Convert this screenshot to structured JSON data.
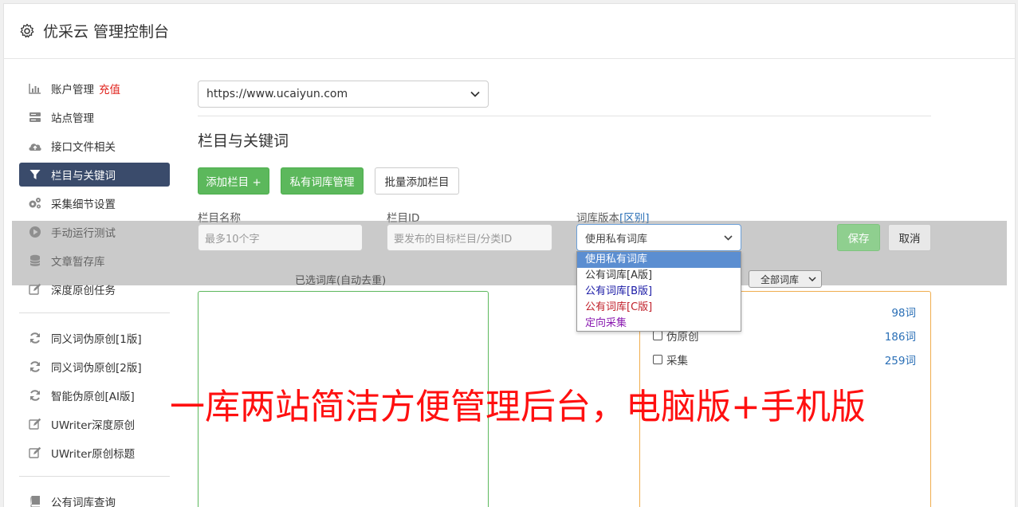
{
  "app": {
    "title": "优采云 管理控制台"
  },
  "sidebar": {
    "items": [
      {
        "label": "账户管理",
        "badge": "充值"
      },
      {
        "label": "站点管理"
      },
      {
        "label": "接口文件相关"
      },
      {
        "label": "栏目与关键词"
      },
      {
        "label": "采集细节设置"
      },
      {
        "label": "手动运行测试"
      },
      {
        "label": "文章暂存库"
      },
      {
        "label": "深度原创任务"
      }
    ],
    "items2": [
      {
        "label": "同义词伪原创[1版]"
      },
      {
        "label": "同义词伪原创[2版]"
      },
      {
        "label": "智能伪原创[AI版]"
      },
      {
        "label": "UWriter深度原创"
      },
      {
        "label": "UWriter原创标题"
      }
    ],
    "items3": [
      {
        "label": "公有词库查询"
      }
    ]
  },
  "site_select": {
    "value": "https://www.ucaiyun.com"
  },
  "section": {
    "title": "栏目与关键词"
  },
  "toolbar": {
    "add_column": "添加栏目 +",
    "private_lib": "私有词库管理",
    "batch_add": "批量添加栏目"
  },
  "form": {
    "name_label": "栏目名称",
    "name_placeholder": "最多10个字",
    "id_label": "栏目ID",
    "id_placeholder": "要发布的目标栏目/分类ID",
    "version_label": "词库版本",
    "version_link": "[区别]",
    "version_value": "使用私有词库",
    "save": "保存",
    "cancel": "取消"
  },
  "dropdown": {
    "options": [
      {
        "label": "使用私有词库",
        "color": "#ffffff"
      },
      {
        "label": "公有词库[A版]",
        "color": "#333333"
      },
      {
        "label": "公有词库[B版]",
        "color": "#1a1aa6"
      },
      {
        "label": "公有词库[C版]",
        "color": "#c0202a"
      },
      {
        "label": "定向采集",
        "color": "#8a1ab0"
      }
    ]
  },
  "selected": {
    "label": "已选词库(自动去重)"
  },
  "libs": {
    "filter": "全部词库",
    "rows": [
      {
        "label": "",
        "count": "98词"
      },
      {
        "label": "伪原创",
        "count": "186词"
      },
      {
        "label": "采集",
        "count": "259词"
      }
    ]
  },
  "banner": {
    "text": "一库两站简洁方便管理后台，电脑版+手机版"
  }
}
